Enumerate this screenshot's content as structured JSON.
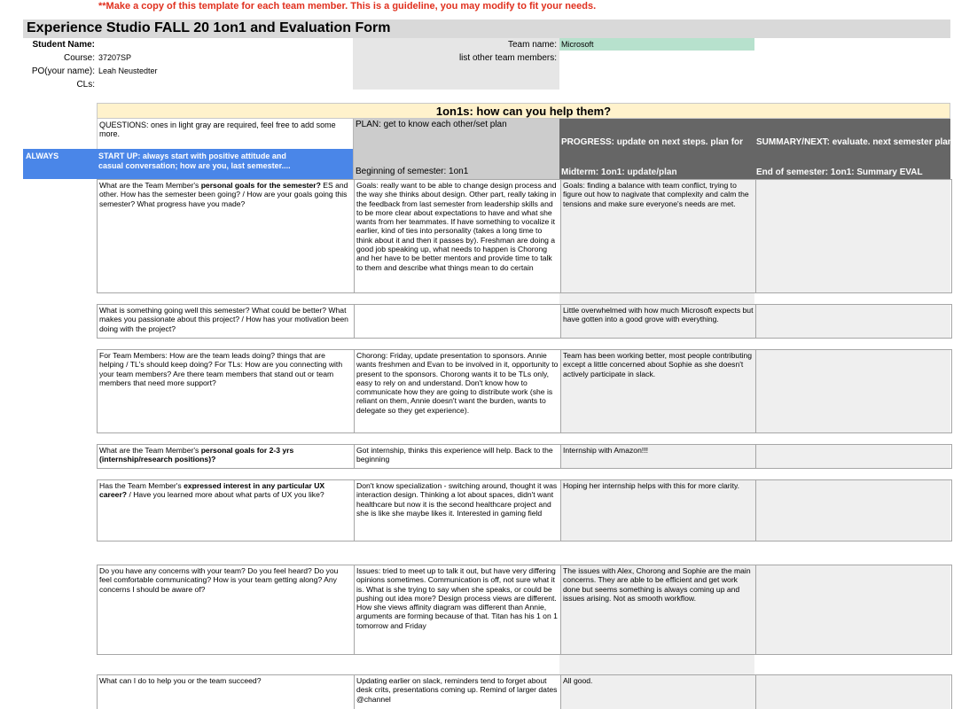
{
  "note": "**Make a copy of this template for each team member. This is a guideline, you may modify to fit your needs.",
  "title": "Experience Studio FALL 20 1on1 and Evaluation Form",
  "info": {
    "student_name_label": "Student Name:",
    "course_label": "Course:",
    "course_value": "37207SP",
    "po_label": "PO(your name):",
    "po_value": "Leah Neustedter",
    "cls_label": "CLs:",
    "team_name_label": "Team name:",
    "team_name_value": "Microsoft",
    "other_members_label": "list other team members:"
  },
  "section_title": "1on1s: how can you help them?",
  "header": {
    "questions": "QUESTIONS: ones in light gray are required, feel free to add some more.",
    "plan": "PLAN: get to know each other/set plan",
    "beginning": "Beginning of semester: 1on1",
    "progress": "PROGRESS: update on next steps. plan for",
    "summary": "SUMMARY/NEXT: evaluate. next semester plans",
    "midterm": "Midterm: 1on1: update/plan",
    "end": "End of semester: 1on1: Summary EVAL"
  },
  "always": {
    "label": "ALWAYS",
    "startup": "START UP: always start with positive attitude and casual conversation; how are you, last semester...."
  },
  "rows": [
    {
      "q_pre": "What are the Team Member's ",
      "q_bold": "personal goals for the semester?",
      "q_post": " ES and other. How has the semester been going? / How are your goals going this semester? What progress have you made?",
      "plan": "Goals: really want to be able to change design process and the way she thinks about design. Other part, really taking in the feedback from last semester from leadership skills and to be more clear about expectations to have and what she wants from her teammates. If have something to vocalize it earlier, kind of ties into personality (takes a long time to think about it and then it passes by). Freshman are doing a good job speaking up, what needs to happen is Chorong and her have to be better mentors and provide time to talk to them and describe what things mean to do certain",
      "mid": "Goals: finding a balance with team conflict, trying to figure out how to nagivate that complexity and calm the tensions and make sure everyone's needs are met.",
      "end": ""
    },
    {
      "q_pre": "What is something going well this semester? What could be better? What makes you passionate about this project? / How has your motivation been doing with the project?",
      "q_bold": "",
      "q_post": "",
      "plan": "",
      "mid": "Little overwhelmed with how much Microsoft expects but have gotten into a good grove with everything.",
      "end": ""
    },
    {
      "q_pre": "For Team Members: How are the team leads doing? things that are helping / TL's should keep doing? For TLs: How are you connecting with your team members? Are there team members that stand out or team members that need more support?",
      "q_bold": "",
      "q_post": "",
      "plan": "Chorong: Friday, update presentation to sponsors. Annie wants freshmen and Evan to be involved in it, opportunity to present to the sponsors. Chorong wants it to be TLs only, easy to rely on and understand. Don't know how to communicate how they are going to distribute work (she is reliant on them, Annie doesn't want the burden, wants to delegate so they get experience).",
      "mid": "Team has been working better, most people contributing except a little concerned about Sophie as she doesn't actively participate in slack.",
      "end": ""
    },
    {
      "q_pre": "What are the Team Member's ",
      "q_bold": "personal goals for 2-3 yrs (internship/research positions)?",
      "q_post": "",
      "plan": "Got internship, thinks this experience will help. Back to the beginning",
      "mid": "Internship with Amazon!!!",
      "end": ""
    },
    {
      "q_pre": "Has the Team Member's ",
      "q_bold": "expressed interest in any particular UX career?",
      "q_post": "  / Have you learned more about what parts of UX you like?",
      "plan": "Don't know specialization - switching around, thought it was interaction design. Thinking a lot about spaces, didn't want healthcare but now it is the second healthcare project and she is like she maybe likes it. Interested in gaming field",
      "mid": "Hoping her internship helps with this for more clarity.",
      "end": ""
    },
    {
      "q_pre": "Do you have any concerns with your team? Do you feel heard? Do you feel comfortable communicating? How is your team getting along? Any concerns I should be aware of?",
      "q_bold": "",
      "q_post": "",
      "plan": "Issues: tried to meet up to talk it out, but have very differing opinions sometimes. Communication is off, not sure what it is. What is she trying to say when she speaks, or could be pushing out idea more? Design process views are different. How she views affinity diagram was different than Annie, arguments are forming because of that. Titan has his 1 on 1 tomorrow and Friday",
      "mid": "The issues with Alex, Chorong and Sophie are the main concerns. They are able to be efficient and get work done but seems something is always coming up and issues arising. Not as smooth workflow.",
      "end": ""
    },
    {
      "q_pre": "What can I do to help you or the team succeed?",
      "q_bold": "",
      "q_post": "",
      "plan": "Updating earlier on slack, reminders tend to forget about desk crits, presentations coming up. Remind of larger dates @channel",
      "mid": "All good.",
      "end": ""
    }
  ]
}
